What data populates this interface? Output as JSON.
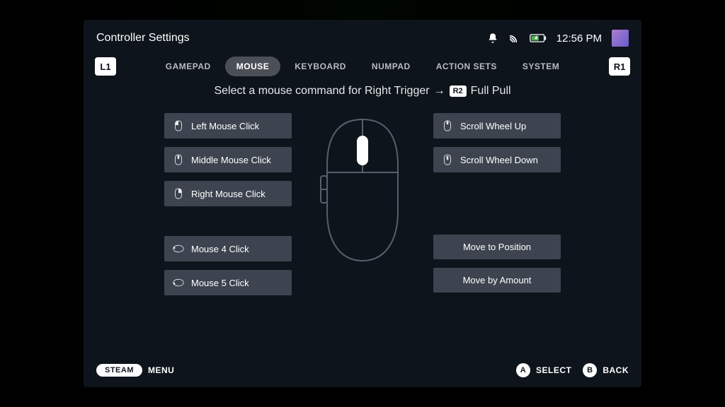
{
  "header": {
    "title": "Controller Settings",
    "time": "12:56 PM"
  },
  "bumpers": {
    "left": "L1",
    "right": "R1"
  },
  "tabs": [
    {
      "label": "GAMEPAD"
    },
    {
      "label": "MOUSE",
      "active": true
    },
    {
      "label": "KEYBOARD"
    },
    {
      "label": "NUMPAD"
    },
    {
      "label": "ACTION SETS"
    },
    {
      "label": "SYSTEM"
    }
  ],
  "prompt": {
    "text": "Select a mouse command for Right Trigger",
    "arrow": "→",
    "key": "R2",
    "suffix": "Full Pull"
  },
  "left_col": {
    "group1": [
      {
        "label": "Left Mouse Click",
        "icon": "mouse-left-icon"
      },
      {
        "label": "Middle Mouse Click",
        "icon": "mouse-middle-icon"
      },
      {
        "label": "Right Mouse Click",
        "icon": "mouse-right-icon"
      }
    ],
    "group2": [
      {
        "label": "Mouse 4 Click",
        "icon": "mouse-side-icon"
      },
      {
        "label": "Mouse 5 Click",
        "icon": "mouse-side-icon"
      }
    ]
  },
  "right_col": {
    "group1": [
      {
        "label": "Scroll Wheel Up",
        "icon": "scroll-up-icon"
      },
      {
        "label": "Scroll Wheel Down",
        "icon": "scroll-down-icon"
      }
    ],
    "group2": [
      {
        "label": "Move to Position"
      },
      {
        "label": "Move by Amount"
      }
    ]
  },
  "footer": {
    "steam": "STEAM",
    "menu": "MENU",
    "a_key": "A",
    "a_label": "SELECT",
    "b_key": "B",
    "b_label": "BACK"
  }
}
